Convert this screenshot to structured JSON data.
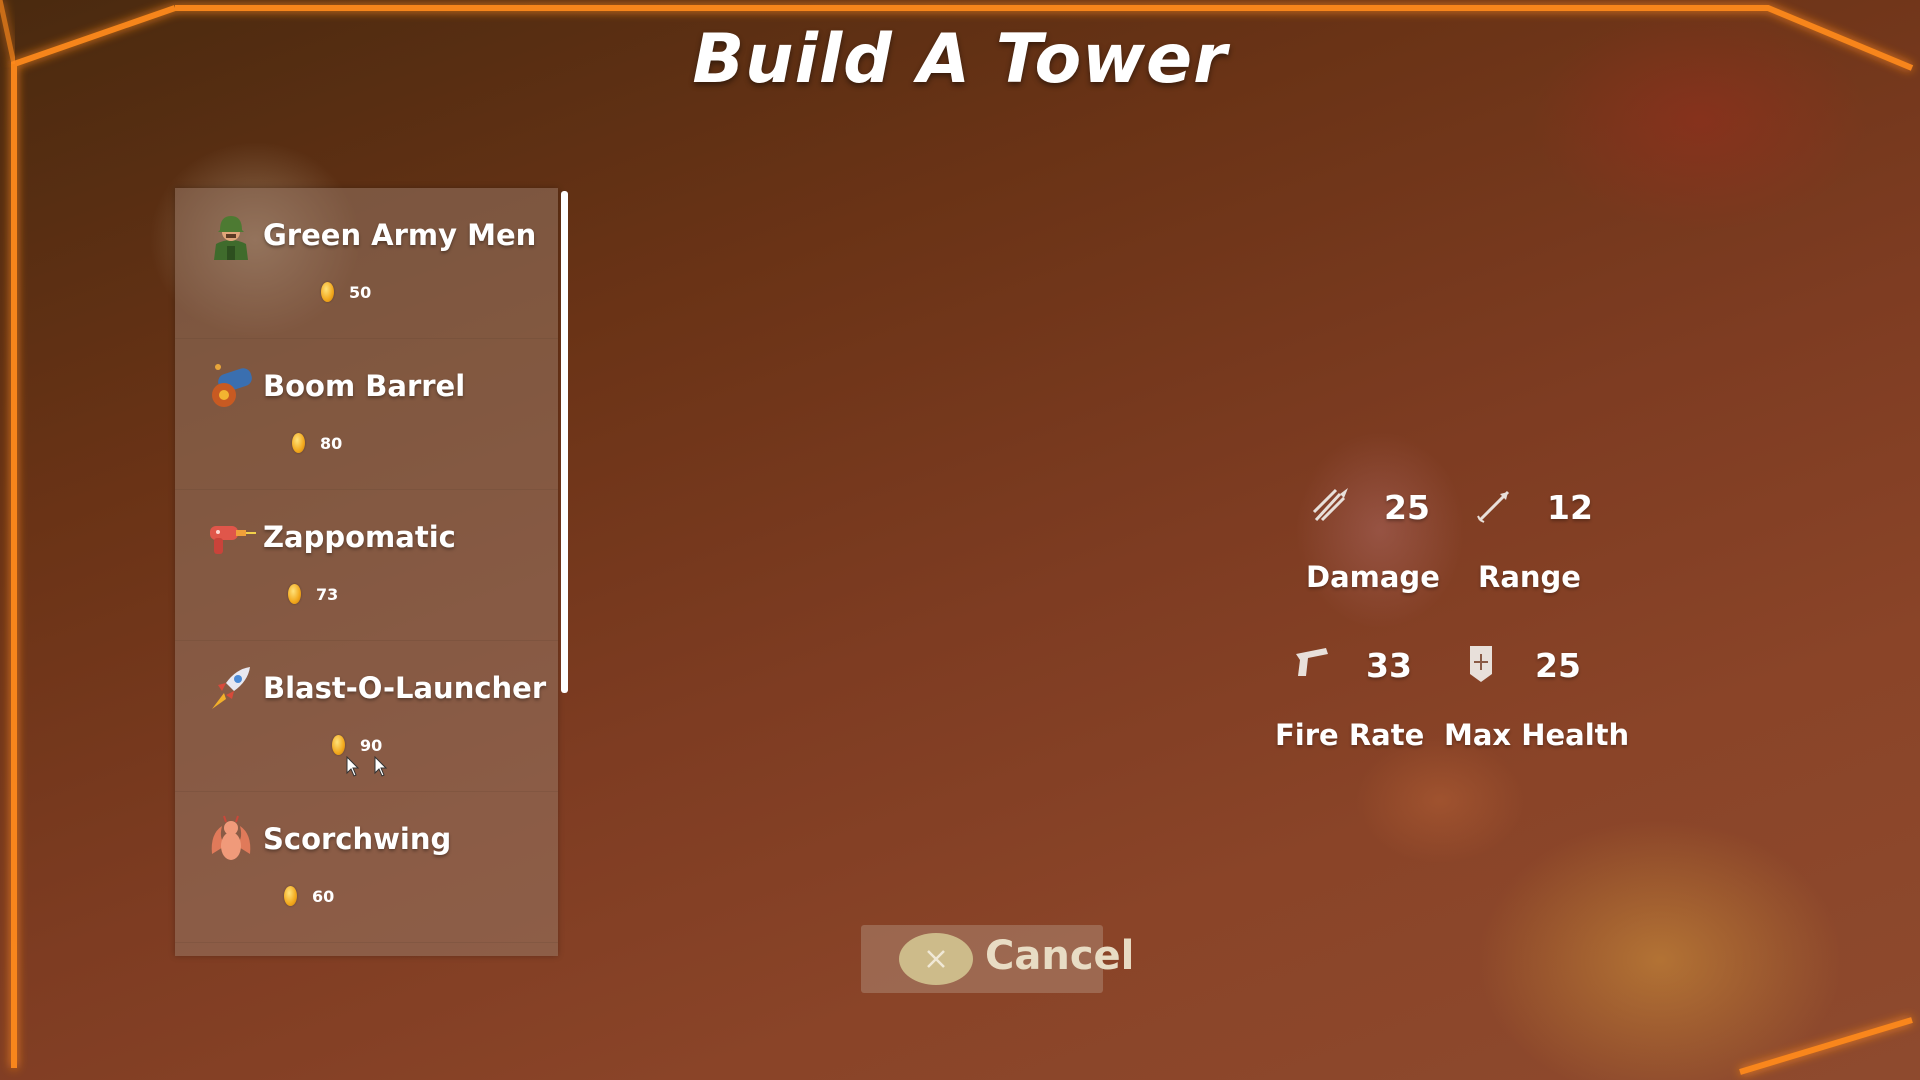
{
  "title": "Build A Tower",
  "towers": [
    {
      "name": "Green Army Men",
      "cost": "50",
      "icon": "soldier-icon"
    },
    {
      "name": "Boom Barrel",
      "cost": "80",
      "icon": "cannon-icon"
    },
    {
      "name": "Zappomatic",
      "cost": "73",
      "icon": "ray-gun-icon"
    },
    {
      "name": "Blast-O-Launcher",
      "cost": "90",
      "icon": "rocket-icon"
    },
    {
      "name": "Scorchwing",
      "cost": "60",
      "icon": "dragon-icon"
    }
  ],
  "stats": {
    "damage": {
      "value": "25",
      "label": "Damage",
      "icon": "damage-icon"
    },
    "range": {
      "value": "12",
      "label": "Range",
      "icon": "range-icon"
    },
    "fire_rate": {
      "value": "33",
      "label": "Fire Rate",
      "icon": "gun-icon"
    },
    "max_health": {
      "value": "25",
      "label": "Max Health",
      "icon": "shield-icon"
    }
  },
  "cancel": {
    "label": "Cancel",
    "icon": "close-icon"
  },
  "colors": {
    "frame": "#ff7a10",
    "coin": "#f2a81c",
    "text": "#ffffff"
  }
}
